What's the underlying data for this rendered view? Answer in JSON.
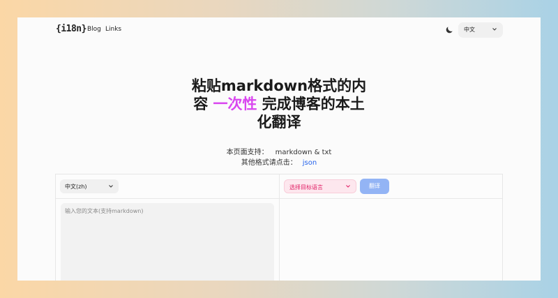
{
  "header": {
    "logo": "{i18n}",
    "nav": [
      {
        "label": "Blog"
      },
      {
        "label": "Links"
      }
    ],
    "language": "中文"
  },
  "hero": {
    "title_line1": "粘贴markdown格式的内",
    "title_line2_pre": "容 ",
    "title_accent": "一次性",
    "title_line2_post": " 完成博客的本土",
    "title_line3": "化翻译"
  },
  "support": {
    "label": "本页面支持：",
    "formats": "markdown & txt",
    "other_label": "其他格式请点击：",
    "other_link": "json"
  },
  "editor": {
    "source_language": "中文(zh)",
    "target_placeholder": "选择目标语言",
    "translate_label": "翻译",
    "input_placeholder": "输入您的文本(支持markdown)"
  },
  "colors": {
    "accent": "#d946ef",
    "link": "#2563eb",
    "translate_button": "#93b4f5",
    "target_select_text": "#e11d64"
  }
}
